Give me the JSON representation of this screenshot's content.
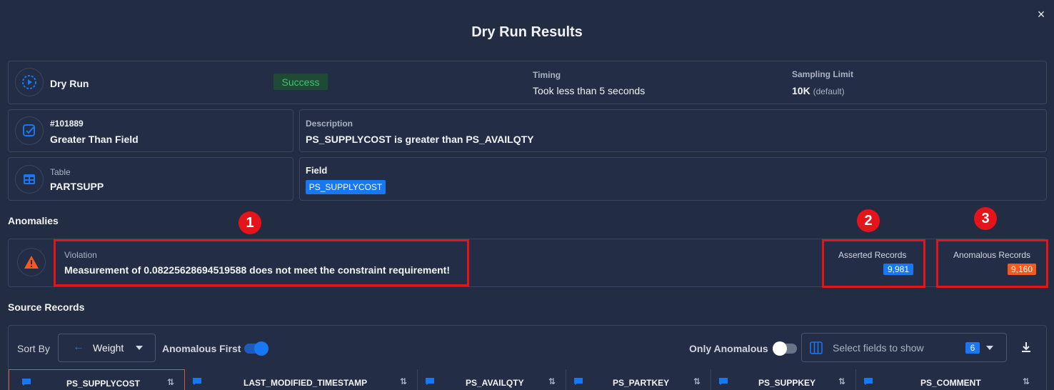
{
  "dialog": {
    "title": "Dry Run Results",
    "close_label": "×"
  },
  "summary": {
    "type_label": "Dry Run",
    "status": "Success",
    "timing_label": "Timing",
    "timing_value": "Took less than 5 seconds",
    "sampling_label": "Sampling Limit",
    "sampling_value": "10K",
    "sampling_note": "(default)"
  },
  "check": {
    "id": "#101889",
    "rule": "Greater Than Field",
    "description_label": "Description",
    "description": "PS_SUPPLYCOST is greater than PS_AVAILQTY"
  },
  "target": {
    "table_label": "Table",
    "table": "PARTSUPP",
    "field_label": "Field",
    "field": "PS_SUPPLYCOST"
  },
  "anomalies": {
    "section_title": "Anomalies",
    "violation_label": "Violation",
    "violation_text": "Measurement of 0.08225628694519588 does not meet the constraint requirement!",
    "asserted_label": "Asserted Records",
    "asserted_count": "9,981",
    "anomalous_label": "Anomalous Records",
    "anomalous_count": "9,160"
  },
  "annotations": [
    "1",
    "2",
    "3"
  ],
  "source_records": {
    "section_title": "Source Records",
    "sort_by_label": "Sort By",
    "sort_value": "Weight",
    "anomalous_first_label": "Anomalous First",
    "anomalous_first_on": true,
    "only_anomalous_label": "Only Anomalous",
    "only_anomalous_on": false,
    "fields_placeholder": "Select fields to show",
    "fields_count": "6",
    "columns": [
      "PS_SUPPLYCOST",
      "LAST_MODIFIED_TIMESTAMP",
      "PS_AVAILQTY",
      "PS_PARTKEY",
      "PS_SUPPKEY",
      "PS_COMMENT"
    ]
  },
  "colors": {
    "background": "#222c43",
    "accent": "#1877f2",
    "success": "#37c96d",
    "warning": "#f45a1e",
    "annotation_red": "#e5141b"
  }
}
